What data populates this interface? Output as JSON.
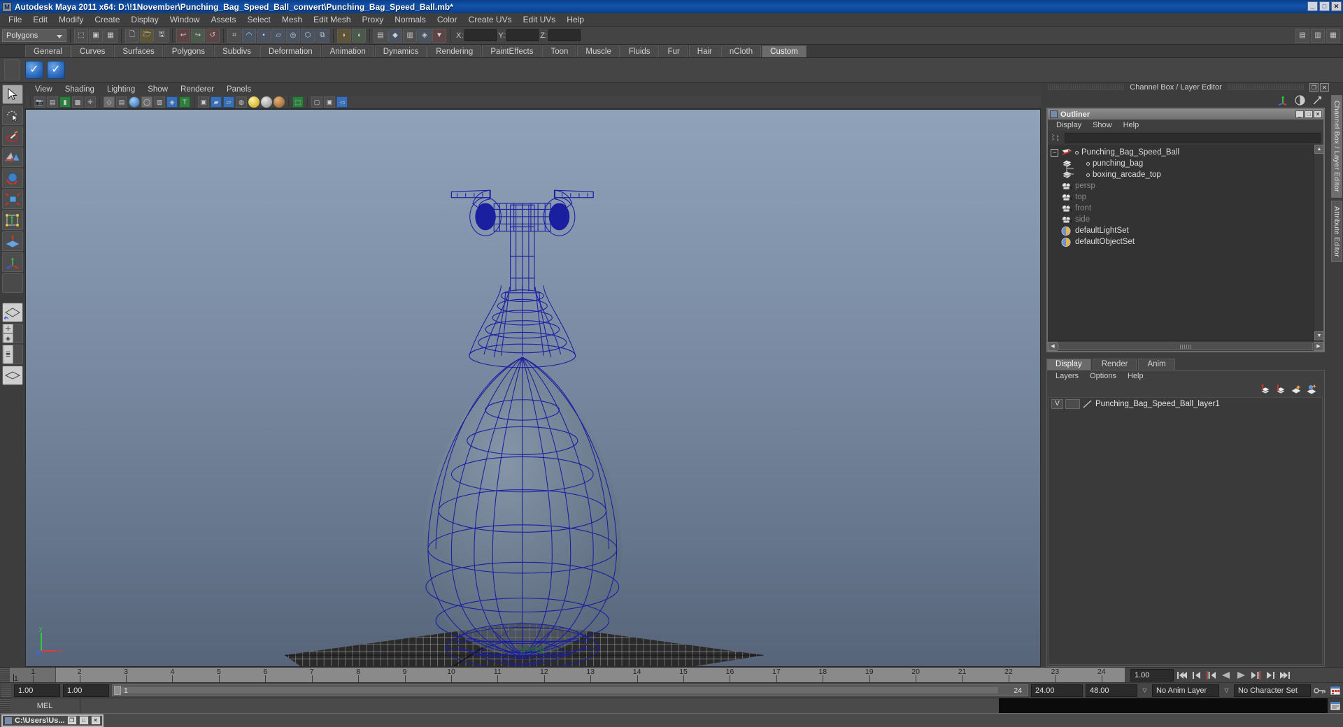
{
  "window": {
    "title": "Autodesk Maya 2011 x64: D:\\!1November\\Punching_Bag_Speed_Ball_convert\\Punching_Bag_Speed_Ball.mb*",
    "minimize": "_",
    "maximize": "□",
    "close": "✕"
  },
  "menubar": {
    "items": [
      "File",
      "Edit",
      "Modify",
      "Create",
      "Display",
      "Window",
      "Assets",
      "Select",
      "Mesh",
      "Edit Mesh",
      "Proxy",
      "Normals",
      "Color",
      "Create UVs",
      "Edit UVs",
      "Help"
    ]
  },
  "statusline": {
    "selection_mode": "Polygons",
    "axis_labels": [
      "X:",
      "Y:",
      "Z:"
    ],
    "axis_values": [
      "",
      "",
      ""
    ]
  },
  "shelf": {
    "tabs": [
      "General",
      "Curves",
      "Surfaces",
      "Polygons",
      "Subdivs",
      "Deformation",
      "Animation",
      "Dynamics",
      "Rendering",
      "PaintEffects",
      "Toon",
      "Muscle",
      "Fluids",
      "Fur",
      "Hair",
      "nCloth",
      "Custom"
    ],
    "active_tab": "Custom",
    "buttons": [
      "check-icon-1",
      "check-icon-2"
    ]
  },
  "toolbox": {
    "items": [
      {
        "name": "select-tool",
        "glyph": "➤",
        "selected": true
      },
      {
        "name": "lasso-tool",
        "glyph": "◌"
      },
      {
        "name": "paint-select-tool",
        "glyph": "🖌"
      },
      {
        "name": "move-tool",
        "glyph": "◣"
      },
      {
        "name": "rotate-tool",
        "glyph": "◉"
      },
      {
        "name": "scale-tool",
        "glyph": "▣"
      },
      {
        "name": "universal-manipulator-tool",
        "glyph": "▦"
      },
      {
        "name": "soft-modification-tool",
        "glyph": "▲"
      },
      {
        "name": "show-manipulator-tool",
        "glyph": "⊹"
      },
      {
        "name": "last-tool-used",
        "glyph": ""
      }
    ]
  },
  "viewport": {
    "panel_menu": [
      "View",
      "Shading",
      "Lighting",
      "Show",
      "Renderer",
      "Panels"
    ],
    "camera_label": "persp",
    "axis": {
      "x": "x",
      "y": "y",
      "z": "z"
    }
  },
  "right_dock": {
    "header_title": "Channel Box / Layer Editor",
    "header_buttons": [
      "restore-icon",
      "close-icon"
    ],
    "vertical_tabs": [
      "Channel Box / Layer Editor",
      "Attribute Editor"
    ],
    "active_vertical_tab": "Channel Box / Layer Editor"
  },
  "outliner": {
    "title": "Outliner",
    "window_buttons": {
      "minimize": "_",
      "maximize": "□",
      "close": "✕"
    },
    "menus": [
      "Display",
      "Show",
      "Help"
    ],
    "search_value": "",
    "items": [
      {
        "label": "Punching_Bag_Speed_Ball",
        "icon": "transform-icon",
        "level": 0,
        "dim": false,
        "expander": "−"
      },
      {
        "label": "punching_bag",
        "icon": "mesh-icon",
        "level": 1,
        "dim": false
      },
      {
        "label": "boxing_arcade_top",
        "icon": "mesh-icon",
        "level": 1,
        "dim": false
      },
      {
        "label": "persp",
        "icon": "camera-icon",
        "level": 0,
        "dim": true
      },
      {
        "label": "top",
        "icon": "camera-icon",
        "level": 0,
        "dim": true
      },
      {
        "label": "front",
        "icon": "camera-icon",
        "level": 0,
        "dim": true
      },
      {
        "label": "side",
        "icon": "camera-icon",
        "level": 0,
        "dim": true
      },
      {
        "label": "defaultLightSet",
        "icon": "set-icon",
        "level": 0,
        "dim": false
      },
      {
        "label": "defaultObjectSet",
        "icon": "set-icon",
        "level": 0,
        "dim": false
      }
    ]
  },
  "layer_editor": {
    "tabs": [
      "Display",
      "Render",
      "Anim"
    ],
    "active_tab": "Display",
    "menus": [
      "Layers",
      "Options",
      "Help"
    ],
    "toolbar_icons": [
      "move-layer-up-icon",
      "move-layer-down-icon",
      "new-layer-icon",
      "new-layer-from-selected-icon"
    ],
    "layers": [
      {
        "visibility": "V",
        "display_type": "",
        "name": "Punching_Bag_Speed_Ball_layer1"
      }
    ]
  },
  "timeslider": {
    "ticks": [
      1,
      2,
      3,
      4,
      5,
      6,
      7,
      8,
      9,
      10,
      11,
      12,
      13,
      14,
      15,
      16,
      17,
      18,
      19,
      20,
      21,
      22,
      23,
      24
    ],
    "current_frame": "1",
    "current_time_field": "1.00",
    "playback_buttons": [
      "go-to-start-icon",
      "step-back-keyframe-icon",
      "step-back-frame-icon",
      "play-backwards-icon",
      "play-forwards-icon",
      "step-forward-frame-icon",
      "step-forward-keyframe-icon",
      "go-to-end-icon"
    ]
  },
  "rangeslider": {
    "start_field": "1.00",
    "end_field": "1.00",
    "range_start_label": "1",
    "range_end_label": "24",
    "playback_start": "24.00",
    "playback_end": "48.00",
    "anim_layer": "No Anim Layer",
    "character_set": "No Character Set",
    "icons": [
      "auto-key-icon",
      "animation-preferences-icon"
    ]
  },
  "command_line": {
    "language_tab": "MEL",
    "input_value": "",
    "script_editor_icon": "script-editor-icon"
  },
  "taskbar": {
    "window_title": "C:\\Users\\Us...",
    "buttons": {
      "restore": "❐",
      "maximize": "□",
      "close": "✕"
    }
  },
  "colors": {
    "title_blue": "#0f4d9e",
    "wireframe_blue": "#1a1fa0",
    "viewport_top": "#8fa0b6",
    "viewport_bottom": "#59667a",
    "persp_green": "#1f6b2c"
  }
}
